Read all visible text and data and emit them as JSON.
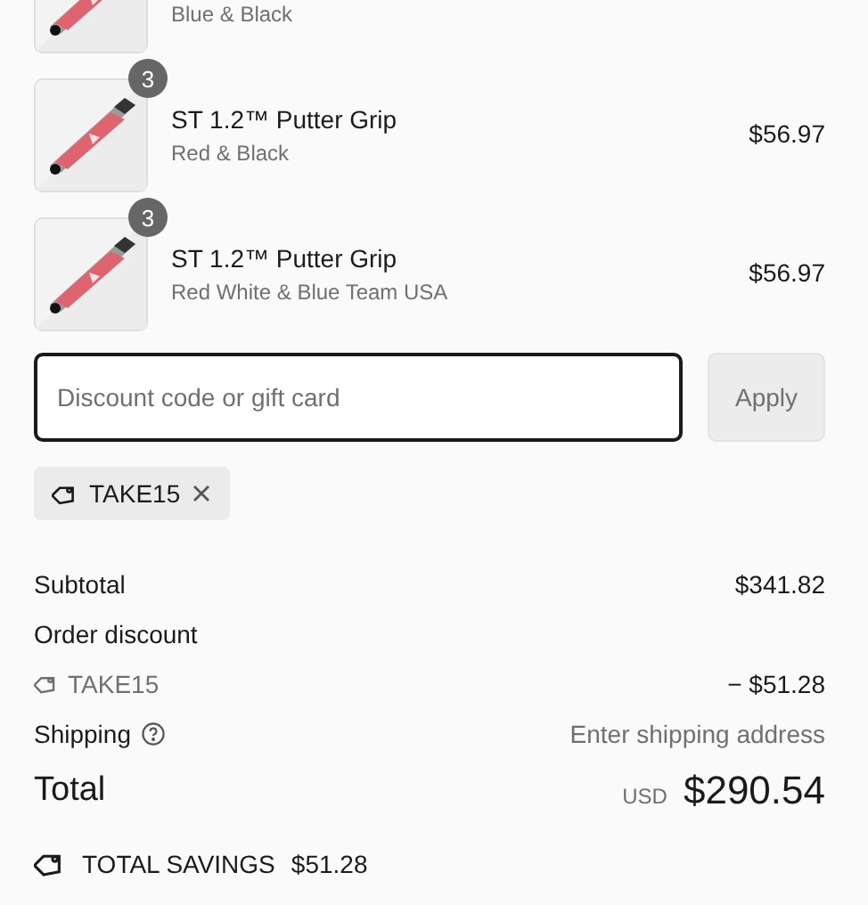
{
  "line_items": [
    {
      "variant": "Blue & Black"
    },
    {
      "quantity": "3",
      "title": "ST 1.2™ Putter Grip",
      "variant": "Red & Black",
      "price": "$56.97"
    },
    {
      "quantity": "3",
      "title": "ST 1.2™ Putter Grip",
      "variant": "Red White & Blue Team USA",
      "price": "$56.97"
    }
  ],
  "discount": {
    "placeholder": "Discount code or gift card",
    "button": "Apply",
    "applied_codes": [
      {
        "code": "TAKE15"
      }
    ]
  },
  "summary": [
    {
      "kind": "amount",
      "label": "Subtotal",
      "value": "$341.82"
    },
    {
      "kind": "heading",
      "label": "Order discount"
    },
    {
      "kind": "code",
      "label": "TAKE15",
      "value": "− $51.28"
    },
    {
      "kind": "shipping",
      "label": "Shipping",
      "value": "Enter shipping address"
    }
  ],
  "total": {
    "label": "Total",
    "currency": "USD",
    "value": "$290.54"
  },
  "savings": {
    "label": "TOTAL SAVINGS",
    "value": "$51.28"
  }
}
